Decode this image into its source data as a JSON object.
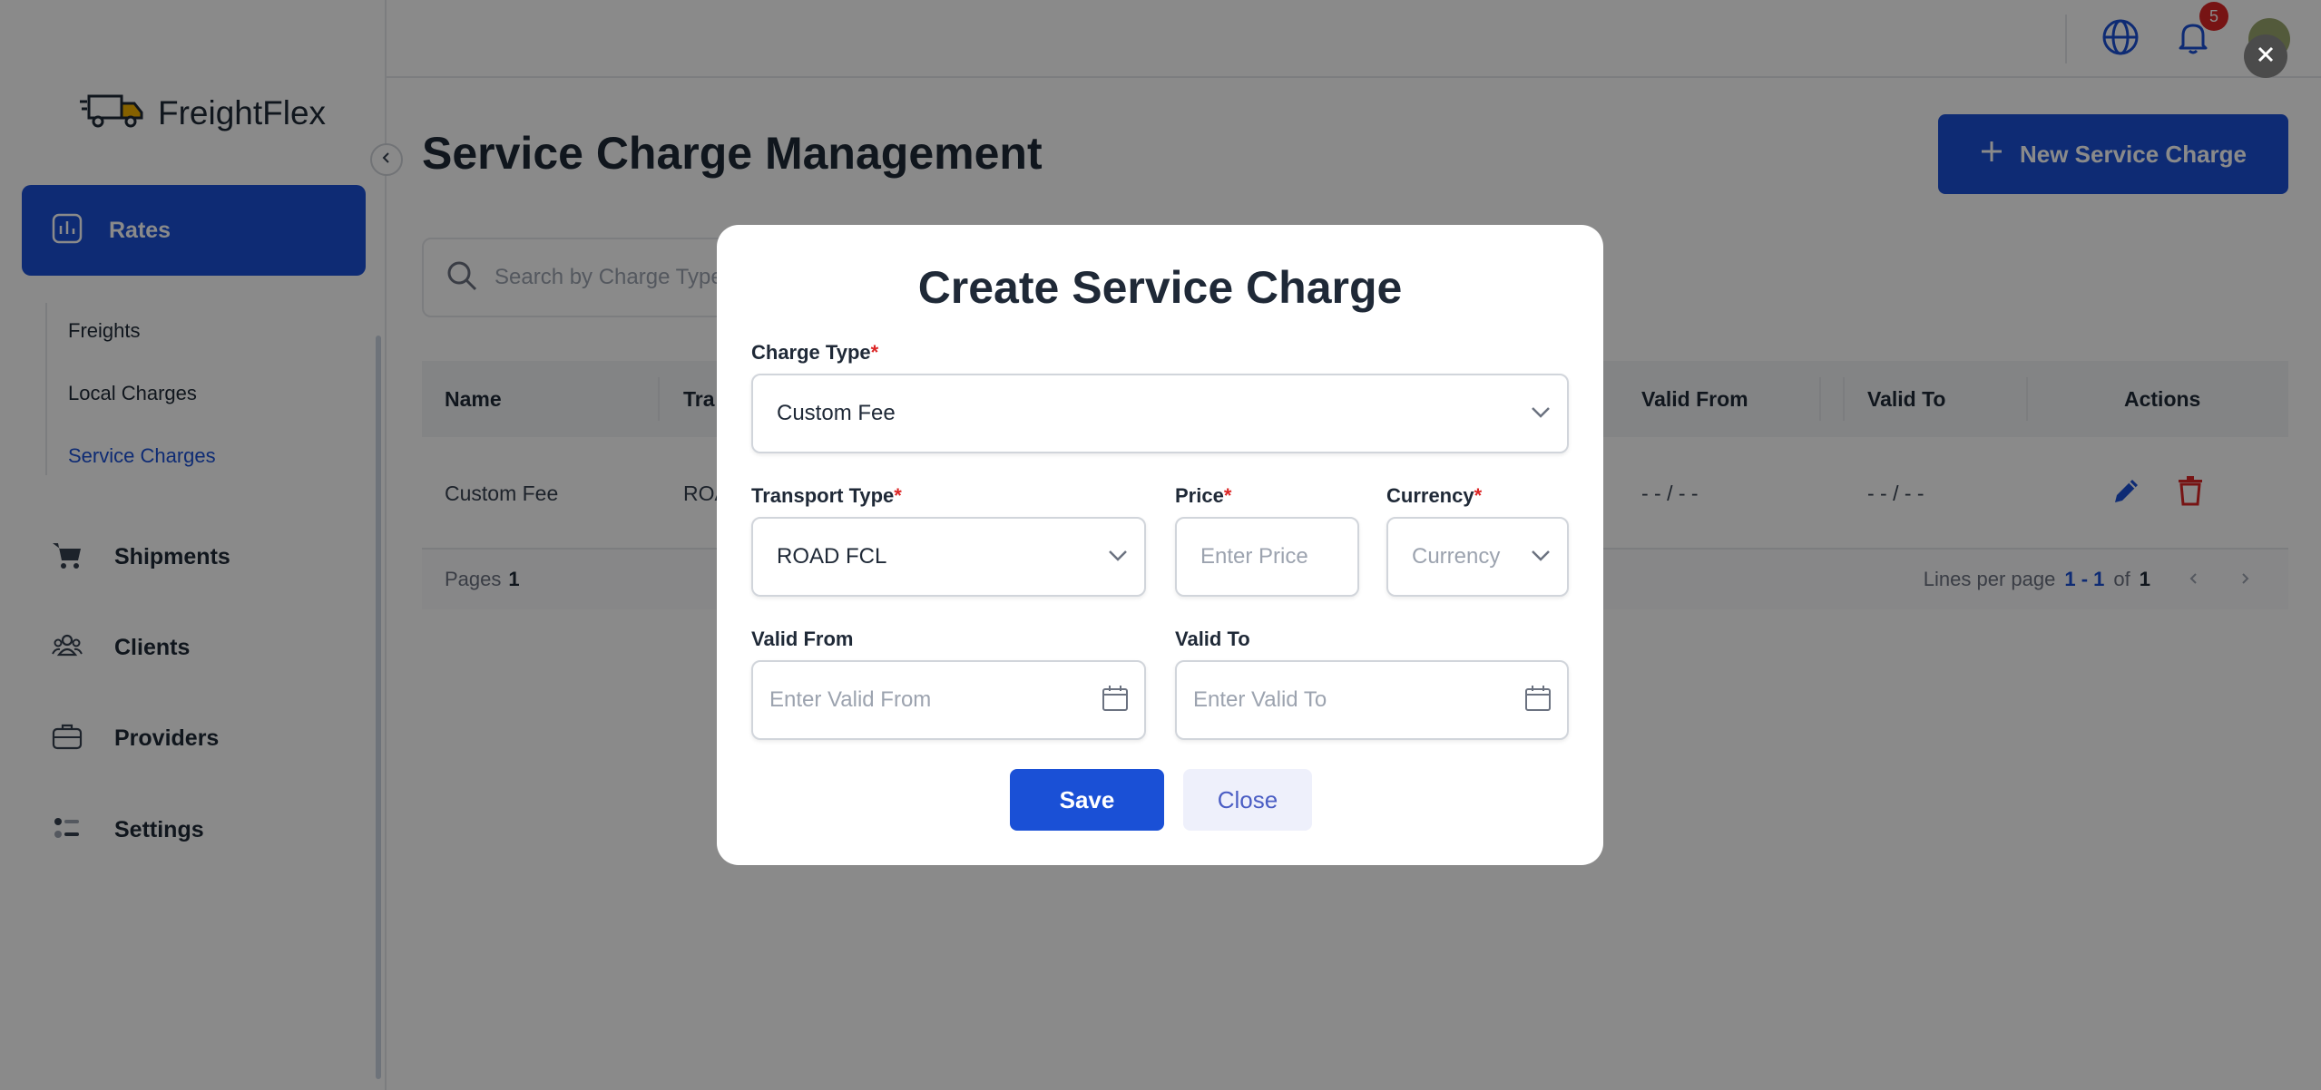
{
  "app": {
    "name": "FreightFlex"
  },
  "topbar": {
    "notification_count": "5"
  },
  "sidebar": {
    "active": {
      "label": "Rates"
    },
    "subitems": [
      "Freights",
      "Local Charges",
      "Service Charges"
    ],
    "items": [
      {
        "label": "Shipments",
        "icon": "cart-icon"
      },
      {
        "label": "Clients",
        "icon": "users-icon"
      },
      {
        "label": "Providers",
        "icon": "briefcase-icon"
      },
      {
        "label": "Settings",
        "icon": "sliders-icon"
      }
    ]
  },
  "page": {
    "title": "Service Charge Management",
    "new_button": "New Service Charge",
    "search_placeholder": "Search by Charge Type"
  },
  "table": {
    "columns": [
      "Name",
      "Tra",
      "Valid From",
      "Valid To",
      "Actions"
    ],
    "rows": [
      {
        "name": "Custom Fee",
        "transport": "ROA",
        "valid_from": "- - / - -",
        "valid_to": "- - / - -"
      }
    ],
    "footer": {
      "pages_label": "Pages",
      "pages_value": "1",
      "lines_label": "Lines per page",
      "range": "1 - 1",
      "of_label": "of",
      "total": "1"
    }
  },
  "modal": {
    "title": "Create Service Charge",
    "charge_type": {
      "label": "Charge Type",
      "value": "Custom Fee"
    },
    "transport_type": {
      "label": "Transport Type",
      "value": "ROAD FCL"
    },
    "price": {
      "label": "Price",
      "placeholder": "Enter Price"
    },
    "currency": {
      "label": "Currency",
      "placeholder": "Currency"
    },
    "valid_from": {
      "label": "Valid From",
      "placeholder": "Enter Valid From"
    },
    "valid_to": {
      "label": "Valid To",
      "placeholder": "Enter Valid To"
    },
    "required_mark": "*",
    "save_label": "Save",
    "close_label": "Close"
  },
  "colors": {
    "primary": "#1a50d6",
    "danger": "#dc2626",
    "overlay": "rgba(0,0,0,0.46)"
  }
}
